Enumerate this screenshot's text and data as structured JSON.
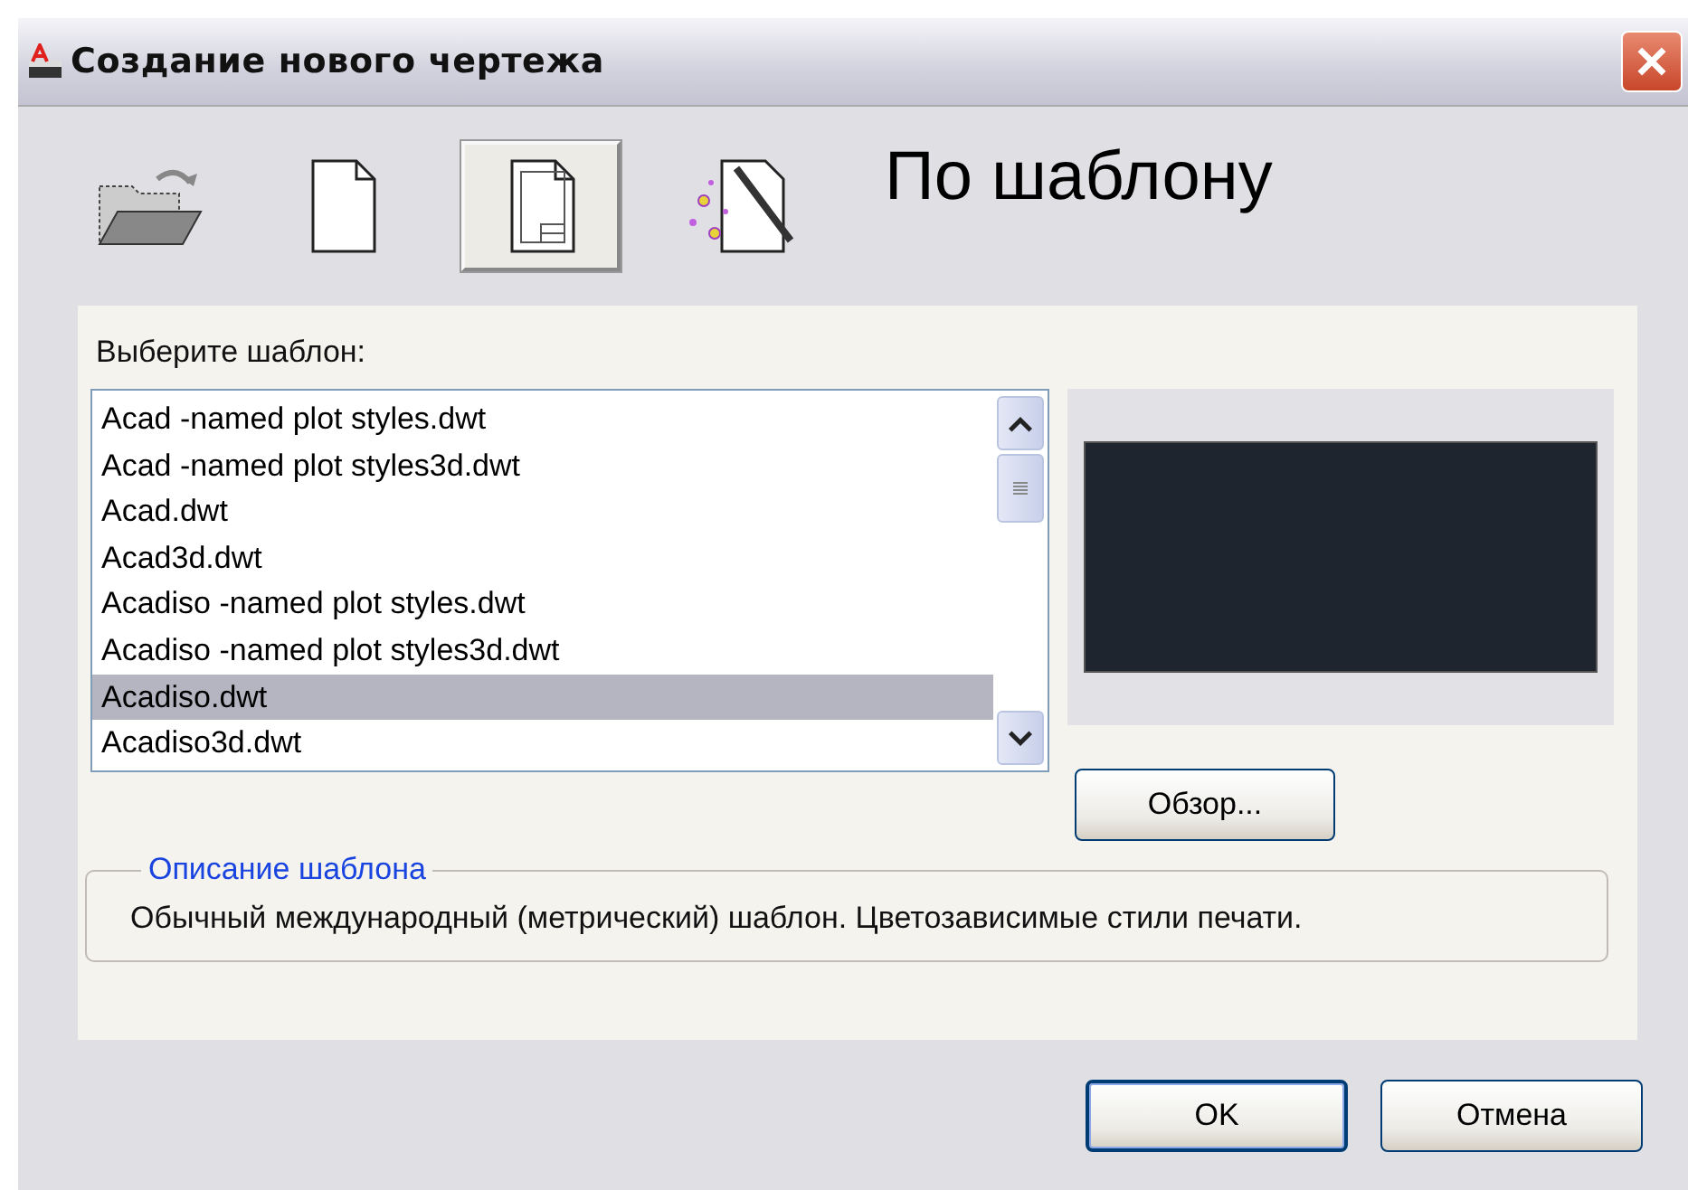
{
  "window": {
    "title": "Создание нового чертежа"
  },
  "modes": [
    {
      "kind": "open",
      "selected": false
    },
    {
      "kind": "blank",
      "selected": false
    },
    {
      "kind": "template",
      "selected": true
    },
    {
      "kind": "wizard",
      "selected": false
    }
  ],
  "heading": "По шаблону",
  "template_label": "Выберите шаблон:",
  "templates": [
    {
      "label": "Acad -named plot styles.dwt",
      "selected": false
    },
    {
      "label": "Acad -named plot styles3d.dwt",
      "selected": false
    },
    {
      "label": "Acad.dwt",
      "selected": false
    },
    {
      "label": "Acad3d.dwt",
      "selected": false
    },
    {
      "label": "Acadiso -named plot styles.dwt",
      "selected": false
    },
    {
      "label": "Acadiso -named plot styles3d.dwt",
      "selected": false
    },
    {
      "label": "Acadiso.dwt",
      "selected": true
    },
    {
      "label": "Acadiso3d.dwt",
      "selected": false
    }
  ],
  "browse_button": "Обзор...",
  "description": {
    "legend": "Описание шаблона",
    "text": "Обычный международный (метрический) шаблон. Цветозависимые стили печати."
  },
  "buttons": [
    "OK",
    "Отмена"
  ]
}
